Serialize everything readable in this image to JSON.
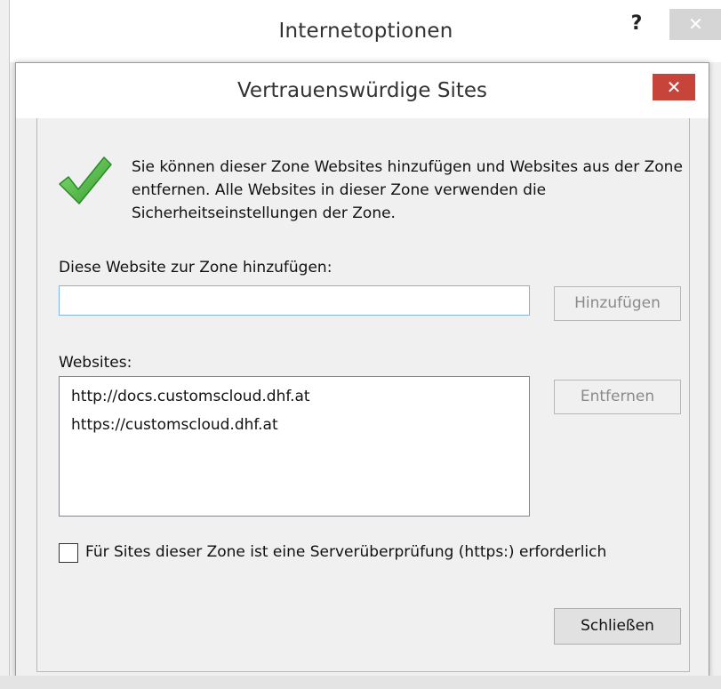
{
  "parent_window": {
    "title": "Internetoptionen",
    "help_label": "?",
    "close_label": "✕"
  },
  "dialog": {
    "title": "Vertrauenswürdige Sites",
    "close_label": "✕",
    "intro_text": "Sie können dieser Zone Websites hinzufügen und Websites aus der Zone entfernen. Alle Websites in dieser Zone verwenden die Sicherheitseinstellungen der Zone.",
    "add_label": "Diese Website zur Zone hinzufügen:",
    "add_input_value": "",
    "add_button": "Hinzufügen",
    "websites_label": "Websites:",
    "websites": [
      "http://docs.customscloud.dhf.at",
      "https://customscloud.dhf.at"
    ],
    "remove_button": "Entfernen",
    "https_checkbox_label": "Für Sites dieser Zone ist eine Serverüberprüfung (https:) erforderlich",
    "https_checkbox_checked": false,
    "close_button": "Schließen"
  },
  "icons": {
    "zone_icon": "green-checkmark-icon"
  },
  "colors": {
    "close_red": "#c7443a",
    "check_green": "#3aa534",
    "focus_border": "#7eb4ea"
  }
}
